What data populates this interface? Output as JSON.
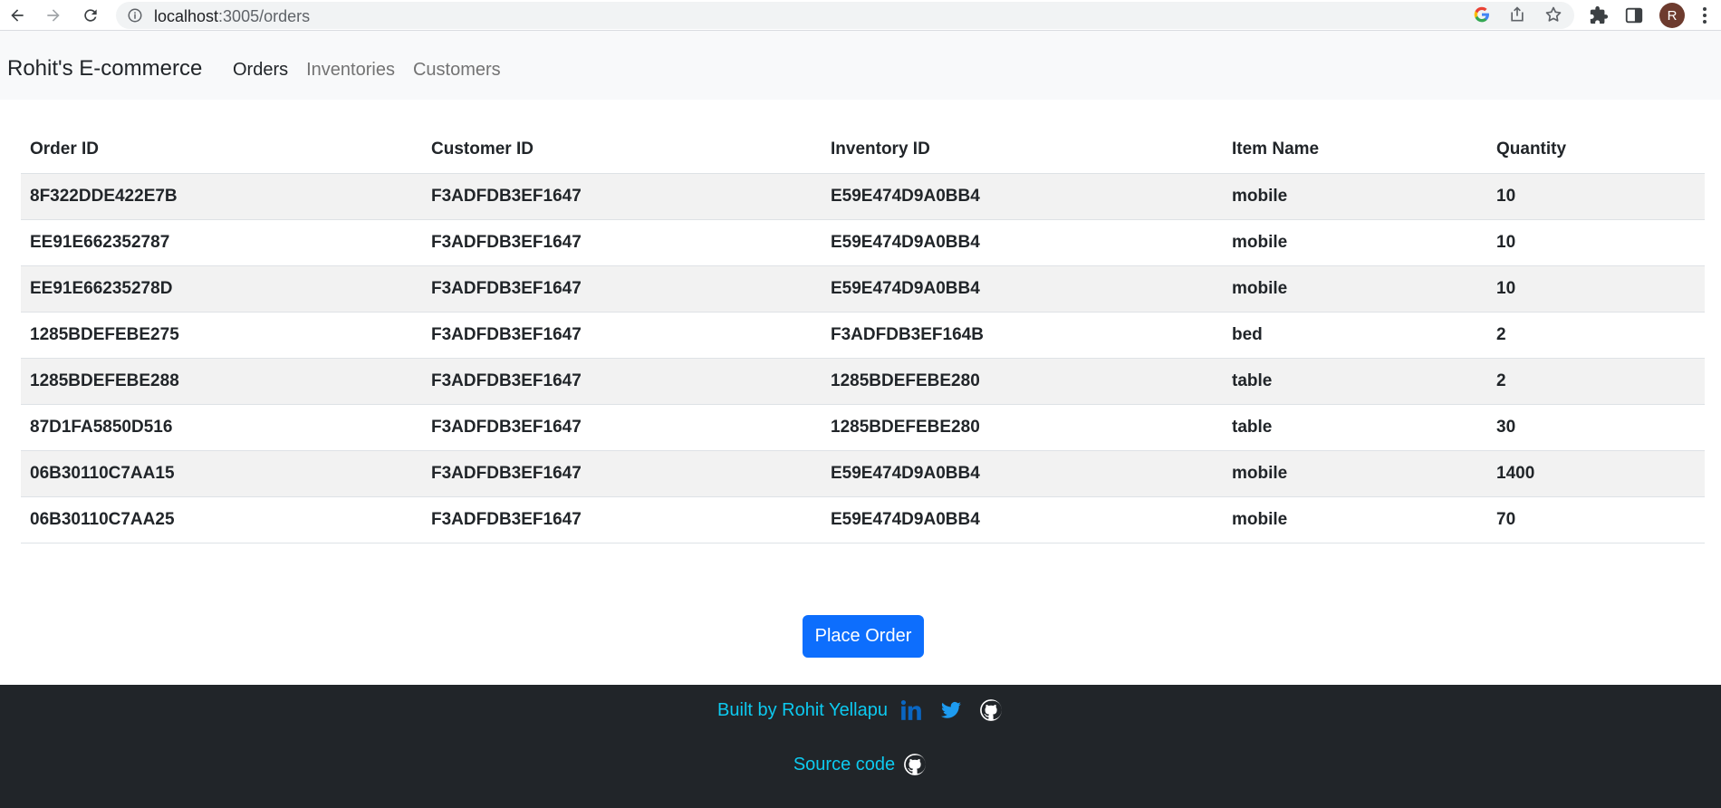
{
  "browser": {
    "url_host": "localhost",
    "url_path": ":3005/orders"
  },
  "navbar": {
    "brand": "Rohit's E-commerce",
    "links": [
      {
        "label": "Orders",
        "active": true
      },
      {
        "label": "Inventories",
        "active": false
      },
      {
        "label": "Customers",
        "active": false
      }
    ]
  },
  "table": {
    "headers": [
      "Order ID",
      "Customer ID",
      "Inventory ID",
      "Item Name",
      "Quantity"
    ],
    "rows": [
      [
        "8F322DDE422E7B",
        "F3ADFDB3EF1647",
        "E59E474D9A0BB4",
        "mobile",
        "10"
      ],
      [
        "EE91E662352787",
        "F3ADFDB3EF1647",
        "E59E474D9A0BB4",
        "mobile",
        "10"
      ],
      [
        "EE91E66235278D",
        "F3ADFDB3EF1647",
        "E59E474D9A0BB4",
        "mobile",
        "10"
      ],
      [
        "1285BDEFEBE275",
        "F3ADFDB3EF1647",
        "F3ADFDB3EF164B",
        "bed",
        "2"
      ],
      [
        "1285BDEFEBE288",
        "F3ADFDB3EF1647",
        "1285BDEFEBE280",
        "table",
        "2"
      ],
      [
        "87D1FA5850D516",
        "F3ADFDB3EF1647",
        "1285BDEFEBE280",
        "table",
        "30"
      ],
      [
        "06B30110C7AA15",
        "F3ADFDB3EF1647",
        "E59E474D9A0BB4",
        "mobile",
        "1400"
      ],
      [
        "06B30110C7AA25",
        "F3ADFDB3EF1647",
        "E59E474D9A0BB4",
        "mobile",
        "70"
      ]
    ]
  },
  "actions": {
    "place_order_label": "Place Order"
  },
  "footer": {
    "built_by": "Built by Rohit Yellapu",
    "source_code": "Source code",
    "icons": [
      "linkedin-icon",
      "twitter-icon",
      "github-icon"
    ]
  },
  "colors": {
    "primary": "#0d6efd",
    "footer_bg": "#212529",
    "footer_link": "#0dcaf0",
    "linkedin": "#0a66c2",
    "twitter": "#1d9bf0"
  }
}
